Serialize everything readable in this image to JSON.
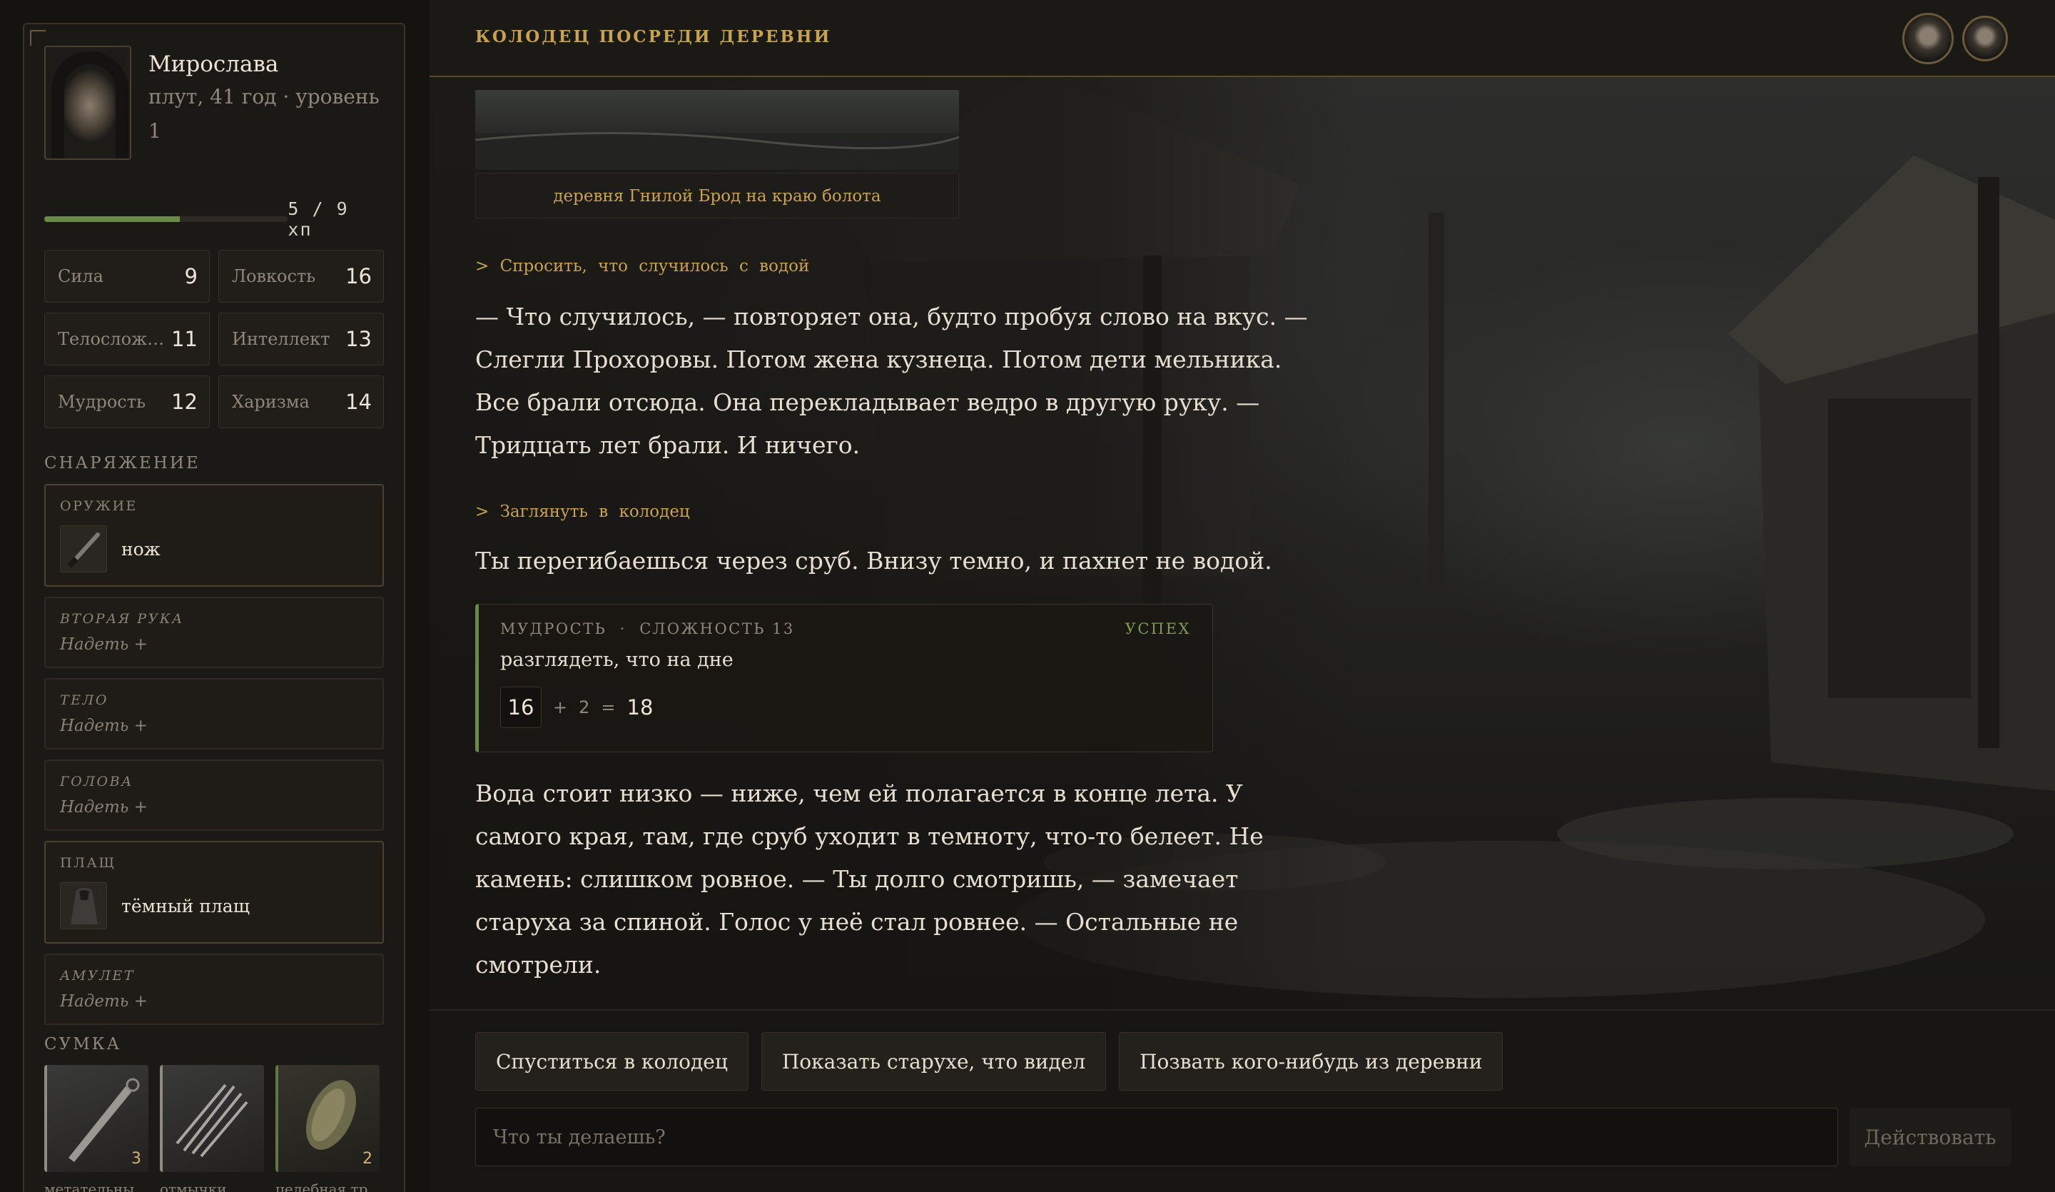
{
  "header": {
    "location": "КОЛОДЕЦ ПОСРЕДИ ДЕРЕВНИ",
    "avatars": [
      "player-avatar",
      "companion-avatar"
    ]
  },
  "character": {
    "name": "Мирослава",
    "subtitle": "плут, 41 год · уровень 1",
    "hp": {
      "current": 5,
      "max": 9,
      "text": "5 / 9 хп",
      "fraction": 0.556
    },
    "stats": [
      {
        "name": "Сила",
        "value": "9"
      },
      {
        "name": "Ловкость",
        "value": "16"
      },
      {
        "name": "Телосложе…",
        "value": "11"
      },
      {
        "name": "Интеллект",
        "value": "13"
      },
      {
        "name": "Мудрость",
        "value": "12"
      },
      {
        "name": "Харизма",
        "value": "14"
      }
    ]
  },
  "equipment": {
    "title": "СНАРЯЖЕНИЕ",
    "empty_label": "Надеть +",
    "slots": [
      {
        "label": "ОРУЖИЕ",
        "item": "нож",
        "icon": "knife-icon"
      },
      {
        "label": "ВТОРАЯ РУКА",
        "item": null
      },
      {
        "label": "ТЕЛО",
        "item": null
      },
      {
        "label": "ГОЛОВА",
        "item": null
      },
      {
        "label": "ПЛАЩ",
        "item": "тёмный плащ",
        "icon": "cloak-icon"
      },
      {
        "label": "АМУЛЕТ",
        "item": null
      }
    ]
  },
  "bag": {
    "title": "СУМКА",
    "items": [
      {
        "name": "метательны…",
        "count": "3",
        "icon": "throwing-knife-icon"
      },
      {
        "name": "отмычки",
        "count": "",
        "icon": "lockpicks-icon"
      },
      {
        "name": "целебная тр…",
        "count": "2",
        "icon": "healing-herb-icon"
      }
    ]
  },
  "story": {
    "image_caption": "деревня Гнилой Брод на краю болота",
    "echo_1": "> Спросить, что случилось с водой",
    "para_1": "— Что случилось, — повторяет она, будто пробуя слово на вкус. — Слегли Прохоровы. Потом жена кузнеца. Потом дети мельника. Все брали отсюда. Она перекладывает ведро в другую руку. — Тридцать лет брали. И ничего.",
    "echo_2": "> Заглянуть в колодец",
    "para_2": "Ты перегибаешься через сруб. Внизу темно, и пахнет не водой.",
    "check": {
      "stat": "МУДРОСТЬ",
      "separator": "·",
      "difficulty": "СЛОЖНОСТЬ 13",
      "result": "УСПЕХ",
      "description": "разглядеть, что на дне",
      "die": "16",
      "plus": "+",
      "modifier": "2",
      "equals": "=",
      "total": "18"
    },
    "para_3": "Вода стоит низко — ниже, чем ей полагается в конце лета. У самого края, там, где сруб уходит в темноту, что-то белеет. Не камень: слишком ровное. — Ты долго смотришь, — замечает старуха за спиной. Голос у неё стал ровнее. — Остальные не смотрели."
  },
  "choices": [
    "Спуститься в колодец",
    "Показать старухе, что видел",
    "Позвать кого-нибудь из деревни"
  ],
  "input": {
    "placeholder": "Что ты делаешь?",
    "value": ""
  },
  "act_button": "Действовать",
  "colors": {
    "accent": "#c9a24e",
    "success": "#6a8a45",
    "background": "#151310"
  }
}
